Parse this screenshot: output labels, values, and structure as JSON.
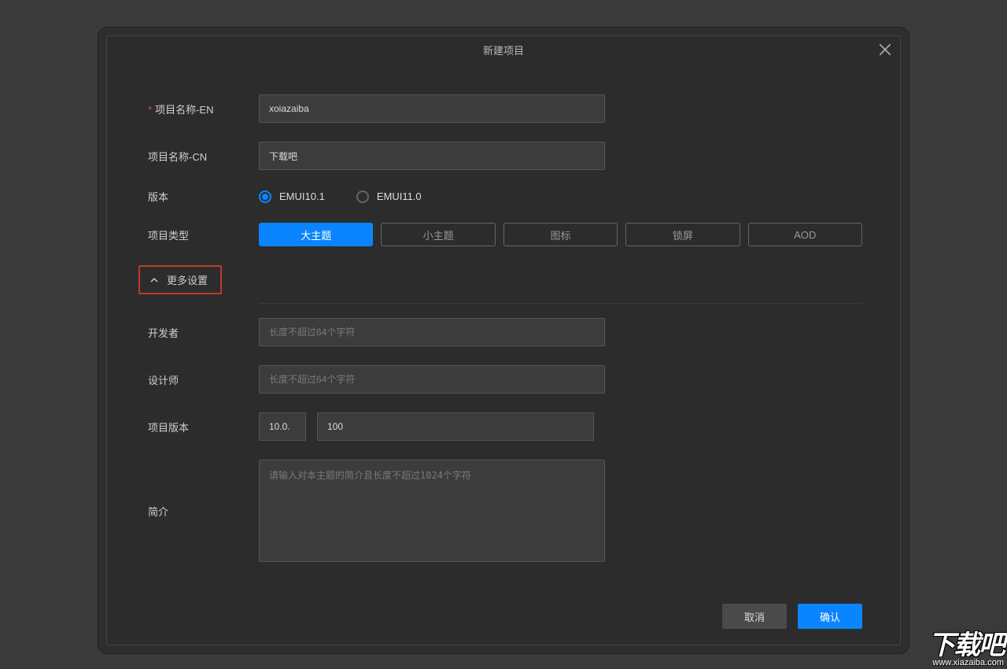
{
  "dialog": {
    "title": "新建项目"
  },
  "fields": {
    "name_en": {
      "label": "项目名称-EN",
      "value": "xoiazaiba",
      "required": true
    },
    "name_cn": {
      "label": "项目名称-CN",
      "value": "下载吧"
    },
    "version": {
      "label": "版本",
      "options": [
        "EMUI10.1",
        "EMUI11.0"
      ],
      "selected": 0
    },
    "type": {
      "label": "项目类型",
      "options": [
        "大主题",
        "小主题",
        "图标",
        "锁屏",
        "AOD"
      ],
      "selected": 0
    },
    "more_settings": {
      "label": "更多设置"
    },
    "developer": {
      "label": "开发者",
      "placeholder": "长度不超过64个字符"
    },
    "designer": {
      "label": "设计师",
      "placeholder": "长度不超过64个字符"
    },
    "project_version": {
      "label": "项目版本",
      "major": "10.0.",
      "minor": "100"
    },
    "description": {
      "label": "简介",
      "placeholder": "请输入对本主题的简介且长度不超过1024个字符"
    }
  },
  "buttons": {
    "cancel": "取消",
    "confirm": "确认"
  },
  "watermark": {
    "brand": "下载吧",
    "url": "www.xiazaiba.com"
  }
}
